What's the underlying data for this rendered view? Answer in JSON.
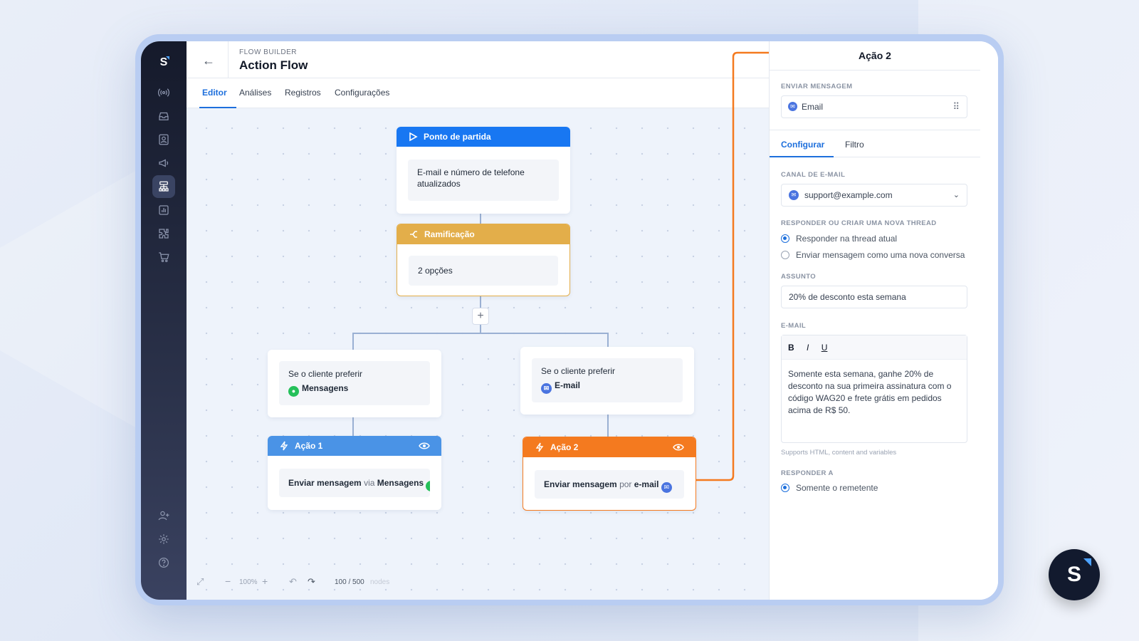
{
  "header": {
    "eyebrow": "FLOW BUILDER",
    "title": "Action Flow"
  },
  "tabs": [
    {
      "label": "Editor"
    },
    {
      "label": "Análises"
    },
    {
      "label": "Registros"
    },
    {
      "label": "Configurações"
    }
  ],
  "nodes": {
    "start": {
      "title": "Ponto de partida",
      "body": "E-mail e número de telefone atualizados"
    },
    "branch": {
      "title": "Ramificação",
      "body": "2 opções"
    },
    "cond1": {
      "line1": "Se o cliente preferir",
      "line2": "Mensagens"
    },
    "cond2": {
      "line1": "Se o cliente preferir",
      "line2": "E-mail"
    },
    "action1": {
      "title": "Ação 1",
      "prefix": "Enviar mensagem",
      "via": "via",
      "channel": "Mensagens"
    },
    "action2": {
      "title": "Ação 2",
      "prefix": "Enviar mensagem",
      "via": "por",
      "channel": "e-mail"
    }
  },
  "bottom": {
    "zoom": "100%",
    "nodes_count": "100 / 500",
    "nodes_label": "nodes"
  },
  "panel": {
    "title": "Ação 2",
    "send_label": "ENVIAR MENSAGEM",
    "send_value": "Email",
    "tabs": [
      {
        "label": "Configurar"
      },
      {
        "label": "Filtro"
      }
    ],
    "channel_label": "CANAL DE E-MAIL",
    "channel_value": "support@example.com",
    "thread_label": "RESPONDER OU CRIAR UMA NOVA THREAD",
    "thread_options": [
      "Responder na thread atual",
      "Enviar mensagem como uma nova conversa"
    ],
    "subject_label": "ASSUNTO",
    "subject_value": "20% de desconto esta semana",
    "email_label": "E-MAIL",
    "toolbar": {
      "bold": "B",
      "italic": "I",
      "underline": "U"
    },
    "email_body": "Somente esta semana, ganhe 20% de desconto na sua primeira assinatura com o código WAG20 e frete grátis em pedidos acima de R$ 50.",
    "email_hint": "Supports HTML, content and variables",
    "reply_label": "RESPONDER A",
    "reply_option": "Somente o remetente"
  },
  "brand": {
    "letter": "S"
  },
  "colors": {
    "start": "#1877f2",
    "branch": "#e3ae4a",
    "action1": "#4a93e6",
    "action2": "#f47a1f",
    "accent": "#1d6fdc"
  }
}
